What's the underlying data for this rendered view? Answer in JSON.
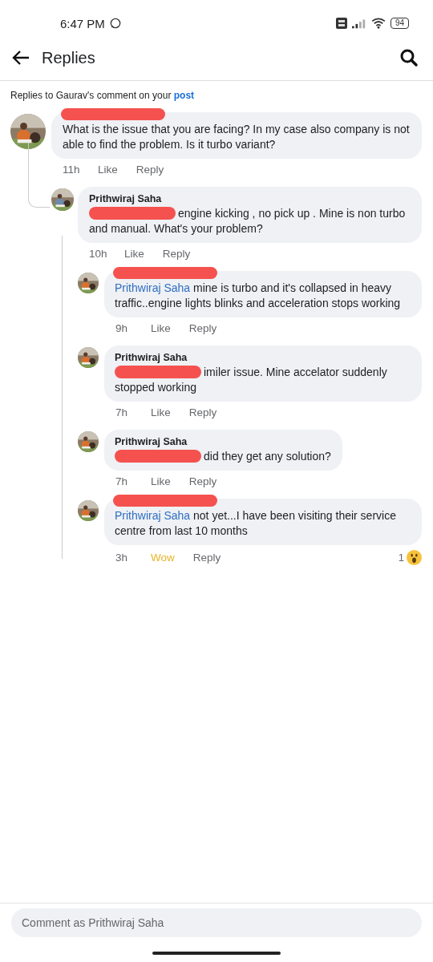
{
  "status_bar": {
    "time": "6:47 PM",
    "battery": "94"
  },
  "header": {
    "title": "Replies"
  },
  "subtitle": {
    "text": "Replies to Gaurav's comment on your ",
    "link": "post"
  },
  "comments": [
    {
      "name_redacted": true,
      "text": "What is the issue that you are facing? In my case also company is not able to find the problem. Is it turbo variant?",
      "time": "11h",
      "reaction_label": "Like",
      "reacted": false,
      "reply_label": "Reply",
      "children": [
        {
          "name": "Prithwiraj Saha",
          "text_redacted": true,
          "text": "engine kicking , no pick up . Mine is non turbo and manual. What's your problem?",
          "time": "10h",
          "reaction_label": "Like",
          "reacted": false,
          "reply_label": "Reply",
          "children": [
            {
              "name_redacted": true,
              "mention": "Prithwiraj Saha",
              "text": "mine is turbo and it's collapsed in heavy traffic..engine lights blinks and acceleration stops working",
              "time": "9h",
              "reaction_label": "Like",
              "reacted": false,
              "reply_label": "Reply"
            },
            {
              "name": "Prithwiraj Saha",
              "text_redacted": true,
              "text": "imiler issue. Mine accelator suddenly stopped working",
              "time": "7h",
              "reaction_label": "Like",
              "reacted": false,
              "reply_label": "Reply"
            },
            {
              "name": "Prithwiraj Saha",
              "text_redacted": true,
              "text": "did they get any solution?",
              "time": "7h",
              "reaction_label": "Like",
              "reacted": false,
              "reply_label": "Reply"
            },
            {
              "name_redacted": true,
              "mention": "Prithwiraj Saha",
              "text": "not yet...I have been visiting their service centre from last 10 months",
              "time": "3h",
              "reaction_label": "Wow",
              "reacted": true,
              "reply_label": "Reply",
              "reaction_count": "1"
            }
          ]
        }
      ]
    }
  ],
  "composer": {
    "placeholder": "Comment as Prithwiraj Saha"
  }
}
